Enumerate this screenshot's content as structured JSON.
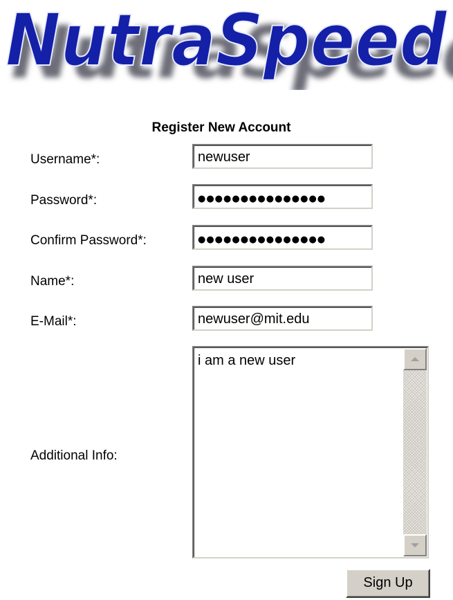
{
  "logo": {
    "text": "NutraSpeed",
    "colors": {
      "fill": "#1420a8",
      "outline": "#ffffff",
      "shadow": "#6d6d78"
    }
  },
  "form": {
    "title": "Register New Account",
    "fields": [
      {
        "label": "Username*:",
        "value": "newuser",
        "type": "text"
      },
      {
        "label": "Password*:",
        "value": "●●●●●●●●●●●●●●●",
        "type": "password"
      },
      {
        "label": "Confirm Password*:",
        "value": "●●●●●●●●●●●●●●●",
        "type": "password"
      },
      {
        "label": "Name*:",
        "value": "new user",
        "type": "text"
      },
      {
        "label": "E-Mail*:",
        "value": "newuser@mit.edu",
        "type": "text"
      }
    ],
    "additional_info": {
      "label": "Additional Info:",
      "value": "i am a new user"
    },
    "submit_label": "Sign Up"
  }
}
